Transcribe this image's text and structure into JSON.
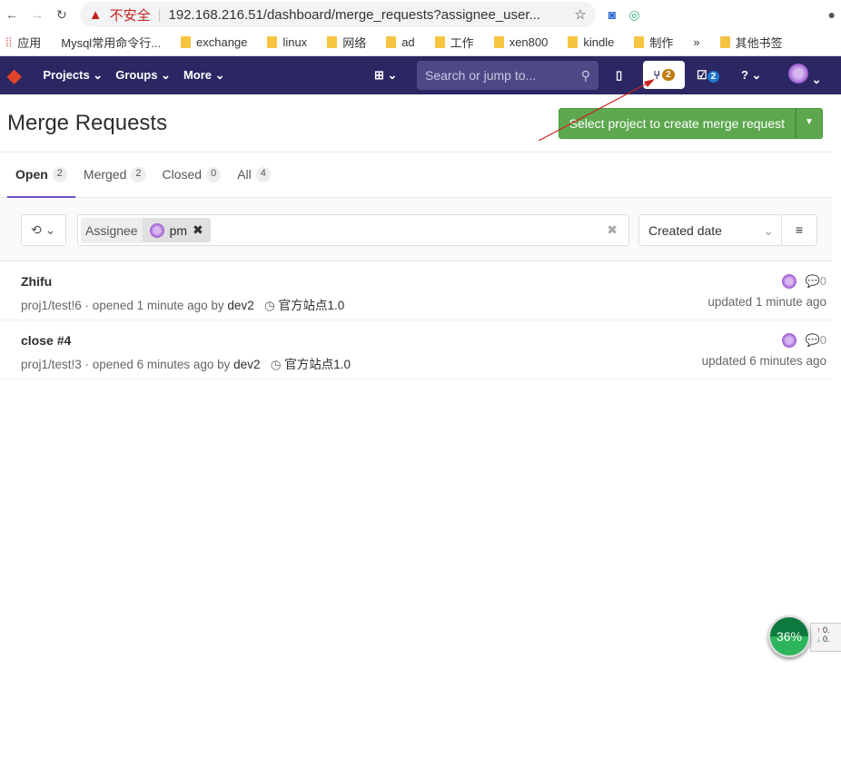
{
  "browser": {
    "insecure": "不安全",
    "url": "192.168.216.51/dashboard/merge_requests?assignee_user...",
    "bookmarks": [
      "应用",
      "Mysql常用命令行...",
      "exchange",
      "linux",
      "网络",
      "ad",
      "工作",
      "xen800",
      "kindle",
      "制作",
      "»",
      "其他书签"
    ]
  },
  "nav": {
    "projects": "Projects ⌄",
    "groups": "Groups ⌄",
    "more": "More ⌄",
    "search_placeholder": "Search or jump to...",
    "mr_count": "2",
    "todo_count": "2"
  },
  "page": {
    "title": "Merge Requests",
    "new_mr": "Select project to create merge request"
  },
  "tabs": [
    {
      "label": "Open",
      "count": "2"
    },
    {
      "label": "Merged",
      "count": "2"
    },
    {
      "label": "Closed",
      "count": "0"
    },
    {
      "label": "All",
      "count": "4"
    }
  ],
  "filter": {
    "token_name": "Assignee",
    "token_value": "pm",
    "sort": "Created date"
  },
  "mrs": [
    {
      "title": "Zhifu",
      "ref": "proj1/test!6 · opened 1 minute ago by",
      "author": "dev2",
      "milestone": "官方站点1.0",
      "comments": "0",
      "updated": "updated 1 minute ago"
    },
    {
      "title": "close #4",
      "ref": "proj1/test!3 · opened 6 minutes ago by",
      "author": "dev2",
      "milestone": "官方站点1.0",
      "comments": "0",
      "updated": "updated 6 minutes ago"
    }
  ],
  "widget": {
    "percent": "36%",
    "up": "0.",
    "down": "0."
  }
}
